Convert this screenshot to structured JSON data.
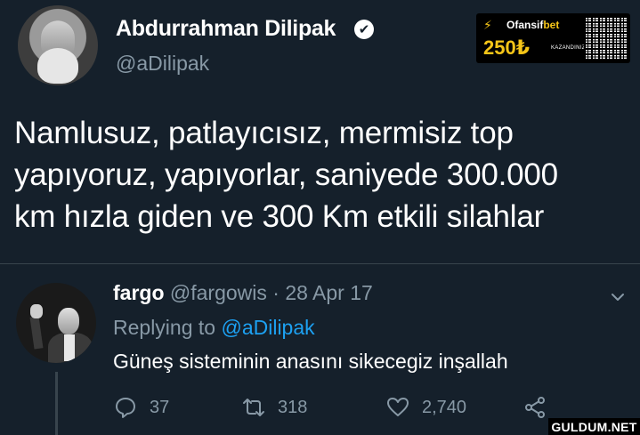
{
  "main_tweet": {
    "author_name": "Abdurrahman Dilipak",
    "verified_mark": "✔",
    "handle": "@aDilipak",
    "text": "Namlusuz, patlayıcısız, mermisiz top\nyapıyoruz, yapıyorlar, saniyede 300.000\nkm hızla giden ve 300 Km etkili silahlar"
  },
  "ad_badge": {
    "runner_icon": "⚡",
    "brand_part1": "Ofansif",
    "brand_part2": "bet",
    "amount": "250₺",
    "caption": "KAZANDINIZ",
    "accent_color": "#f5c518"
  },
  "reply": {
    "author_name": "fargo",
    "meta": "@fargowis · 28 Apr 17",
    "replying_prefix": "Replying to ",
    "replying_mention": "@aDilipak",
    "text": "Güneş sisteminin anasını sikecegiz inşallah",
    "actions": {
      "reply_count": "37",
      "retweet_count": "318",
      "like_count": "2,740"
    }
  },
  "watermark": "GULDUM.NET",
  "colors": {
    "background": "#15202b",
    "secondary_text": "#8899a6",
    "link": "#1da1f2",
    "divider": "#38444d"
  },
  "icons": [
    "verified-badge-icon",
    "chevron-down-icon",
    "reply-icon",
    "retweet-icon",
    "like-icon",
    "share-icon"
  ]
}
